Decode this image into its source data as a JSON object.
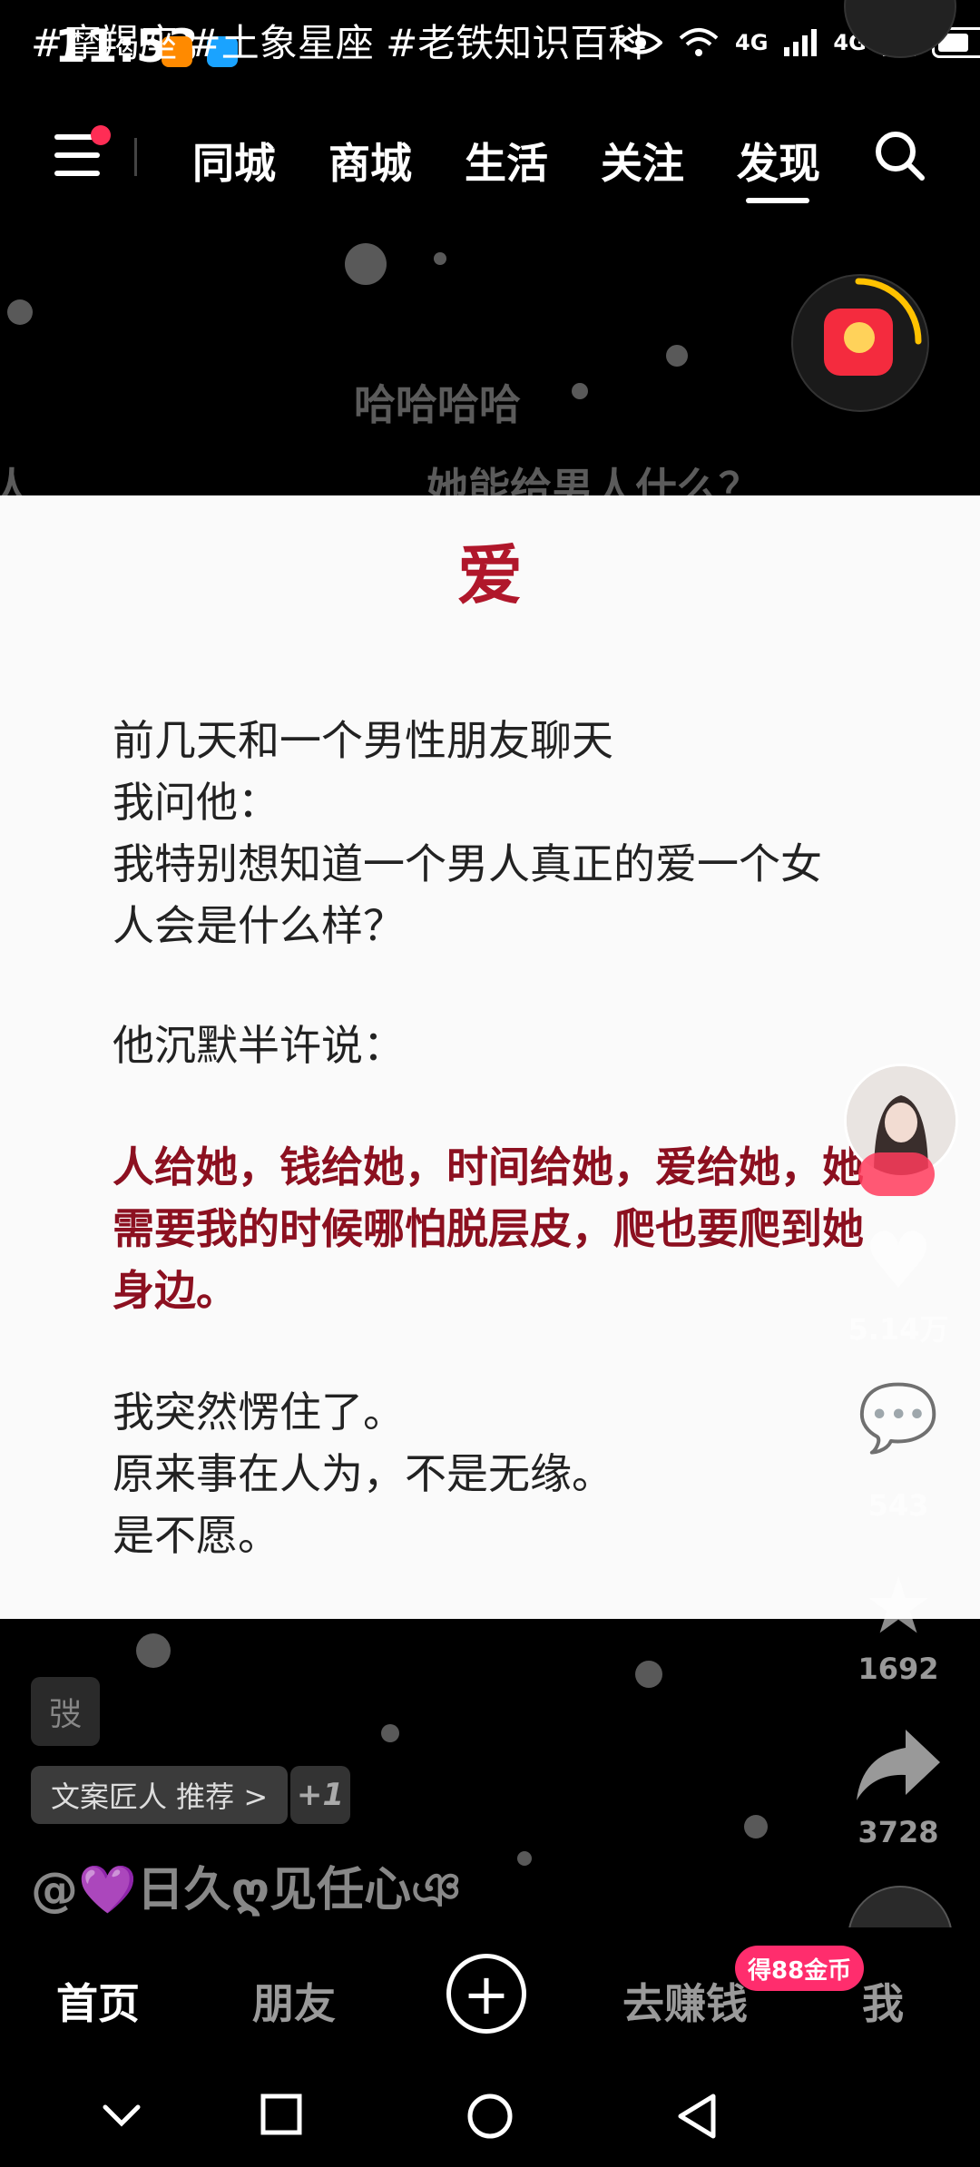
{
  "status_bar": {
    "time": "11:53",
    "network_1": "4G",
    "network_2": "4G",
    "battery_percent": 60,
    "icons": [
      "eye-icon",
      "wifi-icon",
      "signal-icon",
      "signal-icon",
      "battery-icon"
    ]
  },
  "overlay_hashtags": "#摩羯座 #土象星座 #老铁知识百科",
  "top_tabs": [
    "同城",
    "商城",
    "生活",
    "关注",
    "发现"
  ],
  "active_top_tab": "发现",
  "background_texts": {
    "line1": "哈哈哈哈",
    "line2": "她能给男人什么？",
    "left_fragment": "人"
  },
  "card": {
    "title": "爱",
    "lines": [
      "前几天和一个男性朋友聊天",
      "我问他：",
      "我特别想知道一个男人真正的爱一个女",
      "人会是什么样？",
      "他沉默半许说：",
      "人给她，钱给她，时间给她，爱给她，她",
      "需要我的时候哪怕脱层皮，爬也要爬到她",
      "身边。",
      "我突然愣住了。",
      "原来事在人为，不是无缘。",
      "是不愿。"
    ]
  },
  "rail": {
    "like_count": "5.14万",
    "comment_count": "543",
    "favorite_count": "1692",
    "share_count": "3728"
  },
  "tag_chip": "弢",
  "recommend_chip": "文案匠人 推荐 >",
  "plus_one": "+1",
  "author": "@💜日久ღ见任心ঞ",
  "bottom_nav": {
    "home": "首页",
    "friends": "朋友",
    "earn": "去赚钱",
    "me": "我",
    "coin_badge": "得88金币"
  },
  "colors": {
    "accent_red": "#ff2d55",
    "title_red": "#b0172b",
    "quote_red": "#8c1020"
  }
}
